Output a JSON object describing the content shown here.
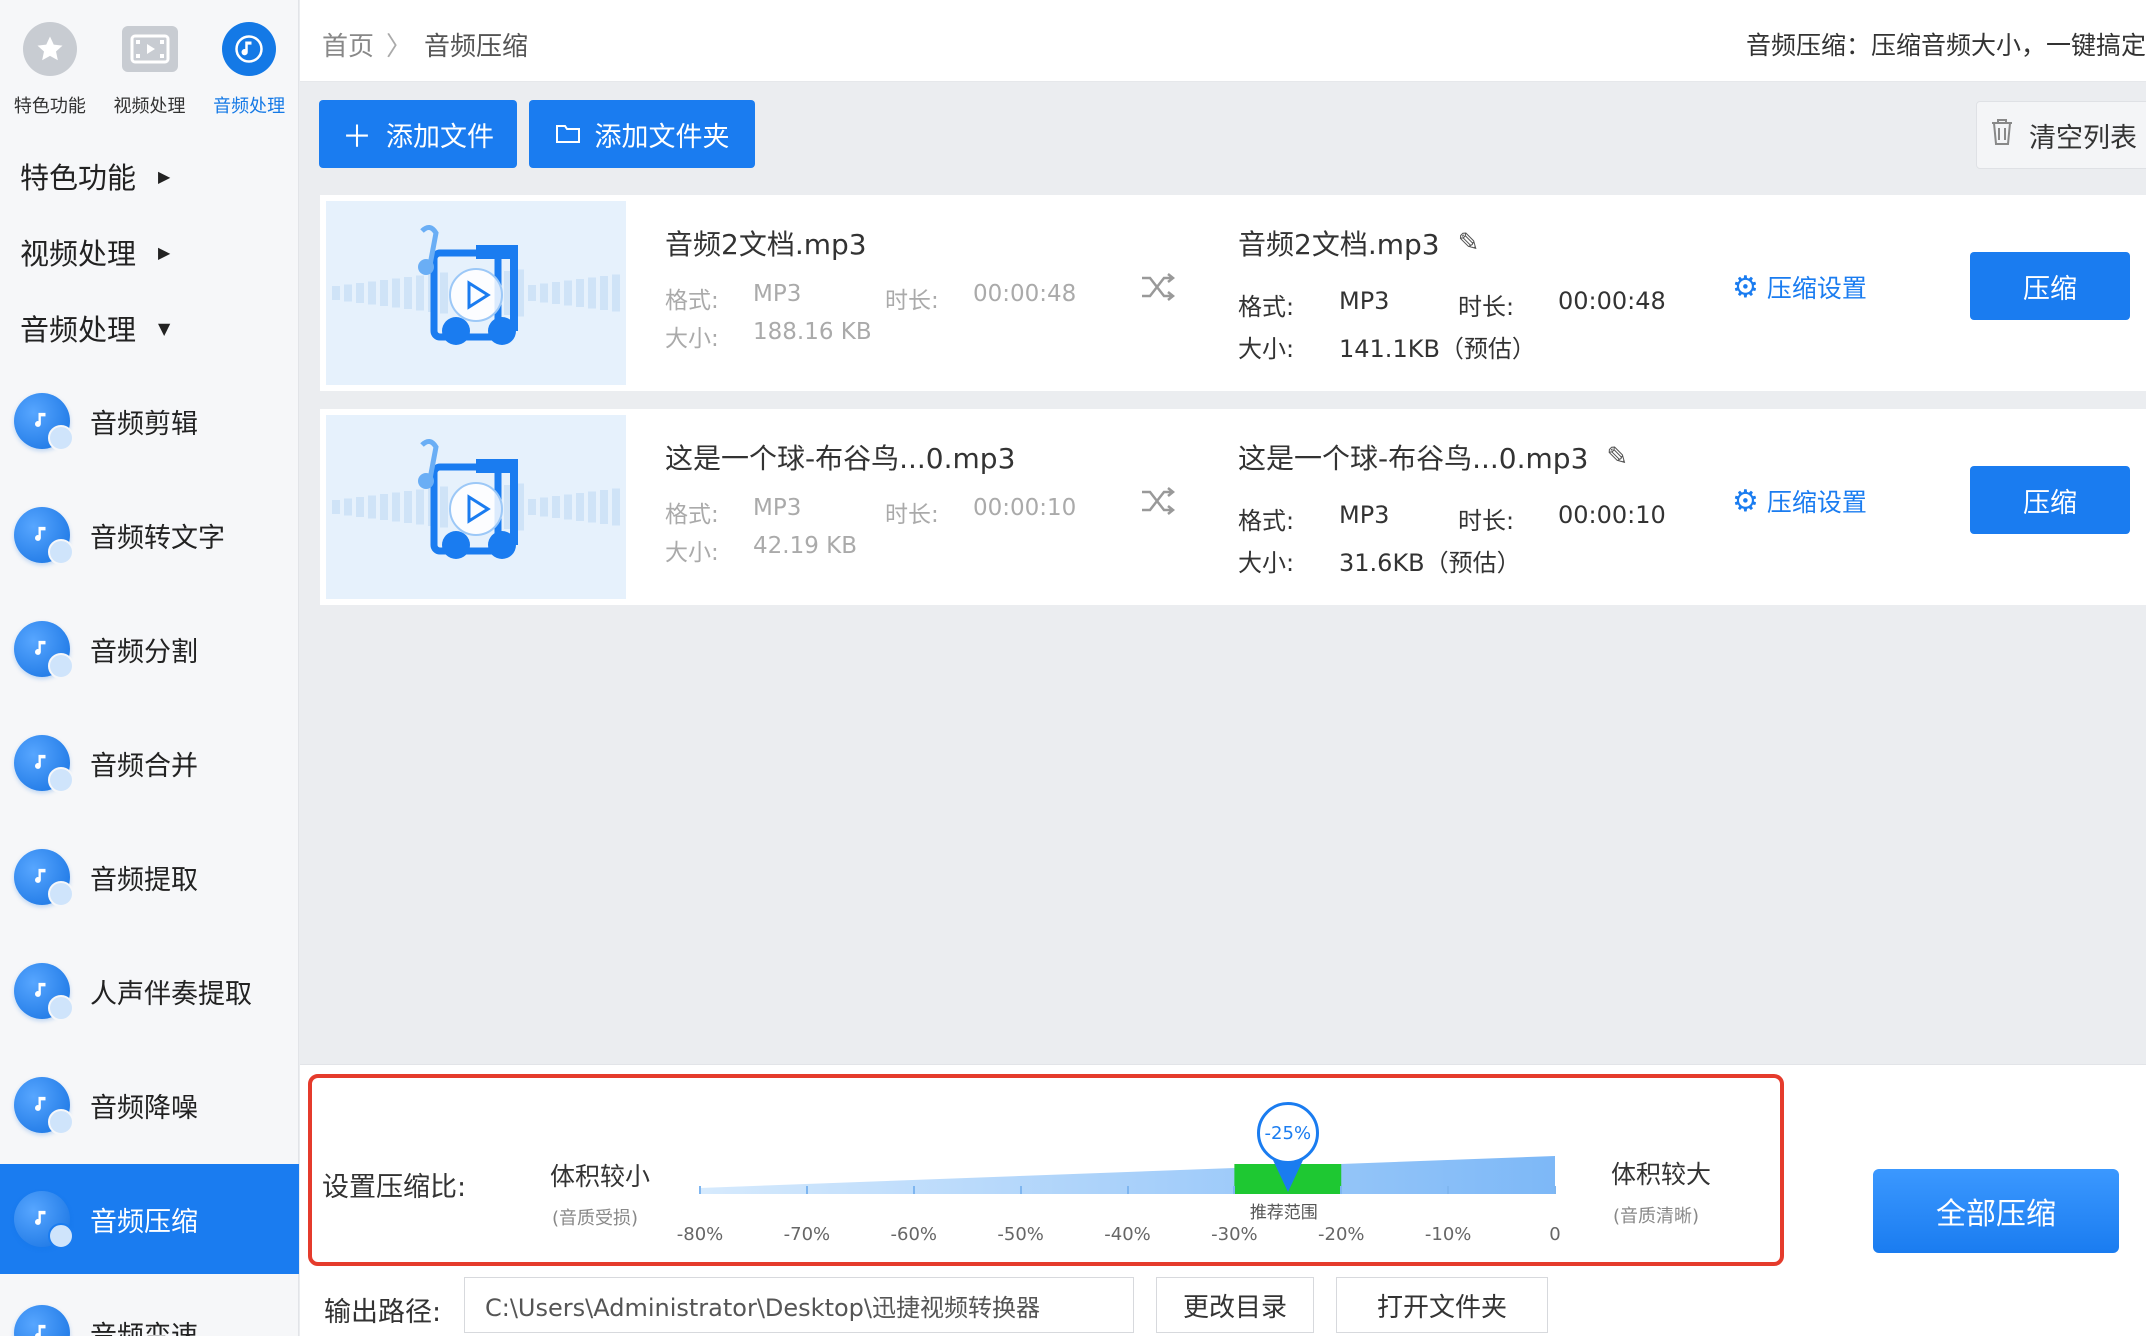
{
  "sidebar": {
    "top_tabs": [
      {
        "label": "特色功能",
        "icon": "star-icon"
      },
      {
        "label": "视频处理",
        "icon": "film-icon"
      },
      {
        "label": "音频处理",
        "icon": "audio-icon"
      }
    ],
    "menu_heads": [
      {
        "label": "特色功能",
        "caret": "▶"
      },
      {
        "label": "视频处理",
        "caret": "▶"
      },
      {
        "label": "音频处理",
        "caret": "▼"
      }
    ],
    "items": [
      {
        "label": "音频剪辑"
      },
      {
        "label": "音频转文字"
      },
      {
        "label": "音频分割"
      },
      {
        "label": "音频合并"
      },
      {
        "label": "音频提取"
      },
      {
        "label": "人声伴奏提取"
      },
      {
        "label": "音频降噪"
      },
      {
        "label": "音频压缩"
      },
      {
        "label": "音频变速"
      }
    ],
    "active_item": "音频压缩"
  },
  "header": {
    "breadcrumb_home": "首页",
    "breadcrumb_sep": "〉",
    "breadcrumb_current": "音频压缩",
    "description": "音频压缩：压缩音频大小，一键搞定"
  },
  "toolbar": {
    "add_file": "添加文件",
    "add_folder": "添加文件夹",
    "clear_list": "清空列表"
  },
  "files": [
    {
      "name": "音频2文档.mp3",
      "format_label": "格式:",
      "format": "MP3",
      "duration_label": "时长:",
      "duration": "00:00:48",
      "size_label": "大小:",
      "size": "188.16 KB",
      "out_name": "音频2文档.mp3",
      "out_format": "MP3",
      "out_duration": "00:00:48",
      "out_size": "141.1KB（预估）",
      "settings": "压缩设置",
      "compress": "压缩"
    },
    {
      "name": "这是一个球-布谷鸟...0.mp3",
      "format_label": "格式:",
      "format": "MP3",
      "duration_label": "时长:",
      "duration": "00:00:10",
      "size_label": "大小:",
      "size": "42.19 KB",
      "out_name": "这是一个球-布谷鸟...0.mp3",
      "out_format": "MP3",
      "out_duration": "00:00:10",
      "out_size": "31.6KB（预估）",
      "settings": "压缩设置",
      "compress": "压缩"
    }
  ],
  "compression": {
    "label": "设置压缩比:",
    "left_title": "体积较小",
    "left_sub": "(音质受损)",
    "right_title": "体积较大",
    "right_sub": "(音质清晰)",
    "ticks": [
      "-80%",
      "-70%",
      "-60%",
      "-50%",
      "-40%",
      "-30%",
      "-20%",
      "-10%",
      "0"
    ],
    "value_label": "-25%",
    "value": -25,
    "recommended_label": "推荐范围",
    "recommended_range": [
      -30,
      -20
    ]
  },
  "compress_all": "全部压缩",
  "output": {
    "label": "输出路径:",
    "path": "C:\\Users\\Administrator\\Desktop\\迅捷视频转换器",
    "change_dir": "更改目录",
    "open_folder": "打开文件夹"
  },
  "colors": {
    "accent": "#1a7cf0",
    "highlight_border": "#e53b2c",
    "recommended": "#1ec832"
  }
}
